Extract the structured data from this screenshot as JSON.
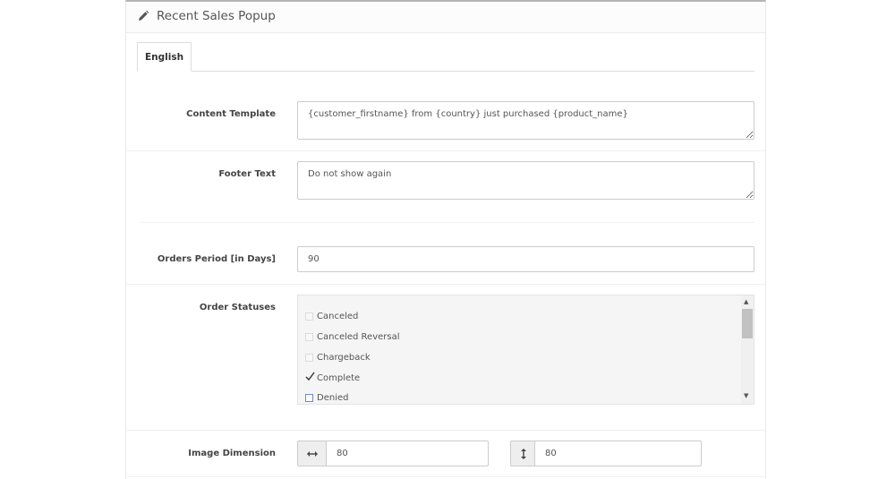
{
  "panel": {
    "title": "Recent Sales Popup",
    "icon": "pencil-icon"
  },
  "tabs": [
    {
      "label": "English",
      "active": true
    }
  ],
  "form": {
    "content_template": {
      "label": "Content Template",
      "value": "{customer_firstname} from {country} just purchased {product_name}"
    },
    "footer_text": {
      "label": "Footer Text",
      "value": "Do not show again"
    },
    "orders_period": {
      "label": "Orders Period [in Days]",
      "value": "90"
    },
    "order_statuses": {
      "label": "Order Statuses",
      "items": [
        {
          "label": "Canceled",
          "checked": false
        },
        {
          "label": "Canceled Reversal",
          "checked": false
        },
        {
          "label": "Chargeback",
          "checked": false
        },
        {
          "label": "Complete",
          "checked": true
        },
        {
          "label": "Denied",
          "checked": false
        }
      ]
    },
    "image_dimension": {
      "label": "Image Dimension",
      "width_icon": "horizontal-arrows-icon",
      "width": "80",
      "height_icon": "vertical-arrows-icon",
      "height": "80"
    }
  }
}
